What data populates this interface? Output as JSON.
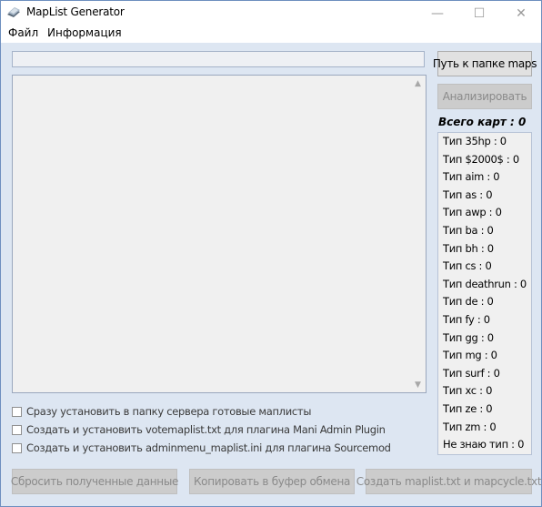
{
  "window": {
    "title": "MapList Generator",
    "minimize_glyph": "—",
    "maximize_glyph": "☐",
    "close_glyph": "✕"
  },
  "menu": {
    "items": [
      "Файл",
      "Информация"
    ]
  },
  "path_field": {
    "value": ""
  },
  "buttons": {
    "map_folder": "Путь к папке maps",
    "analyze": "Анализировать",
    "reset": "Сбросить полученные данные",
    "copy": "Копировать в буфер обмена",
    "create": "Создать maplist.txt и mapcycle.txt"
  },
  "total_maps": "Всего карт : 0",
  "types": [
    "Тип 35hp : 0",
    "Тип $2000$ : 0",
    "Тип aim : 0",
    "Тип as : 0",
    "Тип awp : 0",
    "Тип ba : 0",
    "Тип bh : 0",
    "Тип cs : 0",
    "Тип deathrun : 0",
    "Тип de : 0",
    "Тип fy : 0",
    "Тип gg : 0",
    "Тип mg : 0",
    "Тип surf : 0",
    "Тип xc : 0",
    "Тип ze : 0",
    "Тип zm : 0",
    "Не знаю тип : 0"
  ],
  "options": [
    "Сразу установить в папку сервера готовые маплисты",
    "Создать и установить votemaplist.txt для плагина Mani Admin Plugin",
    "Создать и установить adminmenu_maplist.ini для плагина Sourcemod"
  ],
  "icons": {
    "app": "app-icon",
    "scroll_up": "▲",
    "scroll_down": "▼"
  }
}
